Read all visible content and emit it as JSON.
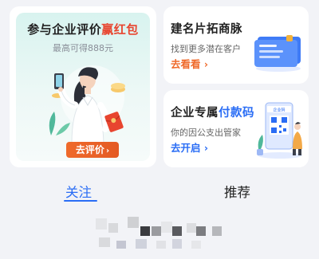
{
  "review_card": {
    "title_prefix": "参与企业评价",
    "title_highlight": "赢红包",
    "subtitle": "最高可得888元",
    "button_label": "去评价",
    "button_arrow": "›"
  },
  "business_card": {
    "title": "建名片拓商脉",
    "subtitle": "找到更多潜在客户",
    "link_label": "去看看",
    "link_arrow": "›"
  },
  "payment_card": {
    "title_prefix": "企业专属",
    "title_highlight": "付款码",
    "subtitle": "你的因公支出管家",
    "link_label": "去开启",
    "link_arrow": "›",
    "illustration_caption": "企业码"
  },
  "tabs": [
    {
      "label": "关注",
      "active": true
    },
    {
      "label": "推荐",
      "active": false
    }
  ],
  "colors": {
    "accent_blue": "#2a6df5",
    "accent_orange": "#ef6a2b",
    "accent_red": "#e8452f"
  },
  "icons": [
    "woman-with-phone-illustration",
    "red-envelope-icon",
    "business-card-icon",
    "qr-code-phone-icon"
  ]
}
